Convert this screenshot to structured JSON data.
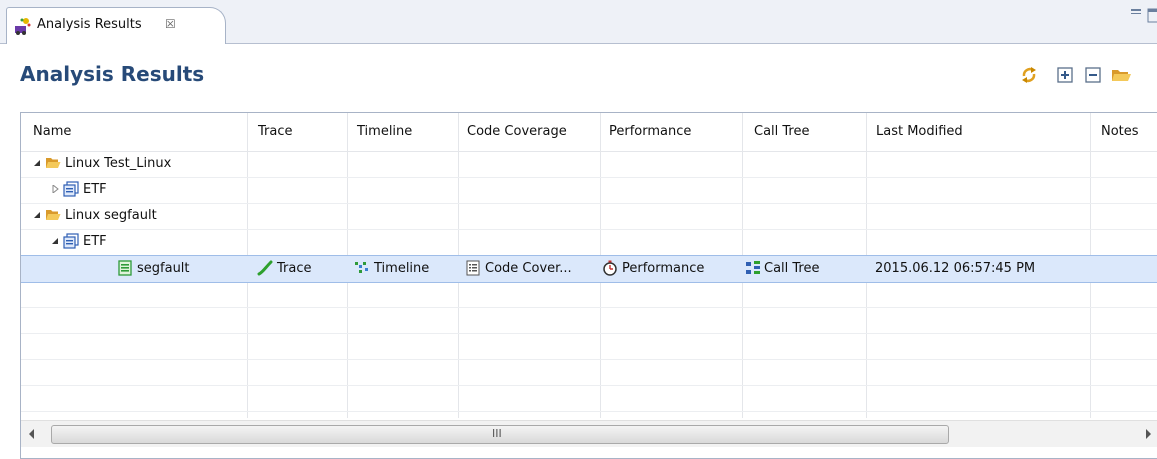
{
  "tab": {
    "title": "Analysis Results",
    "close_glyph": "☒"
  },
  "view": {
    "title": "Analysis Results"
  },
  "toolbar": {
    "icons": [
      "refresh-icon",
      "expand-all-icon",
      "collapse-all-icon",
      "open-folder-icon"
    ]
  },
  "table": {
    "columns": [
      "Name",
      "Trace",
      "Timeline",
      "Code Coverage",
      "Performance",
      "Call Tree",
      "Last Modified",
      "Notes"
    ],
    "rows": [
      {
        "name": "Linux Test_Linux",
        "icon": "folder-icon",
        "expanded": true
      },
      {
        "name": "ETF",
        "icon": "etf-icon",
        "expanded": false
      },
      {
        "name": "Linux segfault",
        "icon": "folder-icon",
        "expanded": true
      },
      {
        "name": "ETF",
        "icon": "etf-icon",
        "expanded": true
      },
      {
        "name": "segfault",
        "icon": "data-file-icon",
        "selected": true,
        "trace": "Trace",
        "timeline": "Timeline",
        "code_coverage": "Code Cover...",
        "performance": "Performance",
        "call_tree": "Call Tree",
        "last_modified": "2015.06.12 06:57:45 PM",
        "notes": ""
      }
    ]
  },
  "scrollbar": {
    "grip": "III"
  },
  "colors": {
    "title": "#274a78",
    "selection": "#dbe8fb",
    "folder": "#f0b94a",
    "etf": "#2f5fb3",
    "data_file": "#2e9a3a"
  }
}
